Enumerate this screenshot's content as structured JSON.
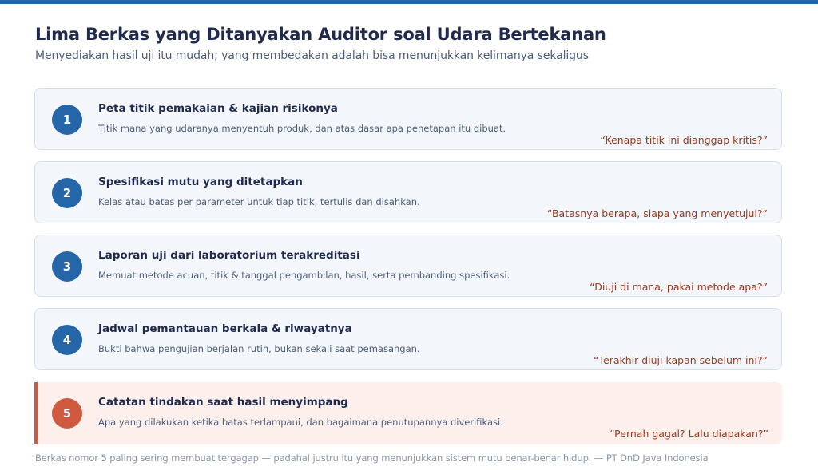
{
  "header": {
    "title": "Lima Berkas yang Ditanyakan Auditor soal Udara Bertekanan",
    "subtitle": "Menyediakan hasil uji itu mudah; yang membedakan adalah bisa menunjukkan kelimanya sekaligus"
  },
  "colors": {
    "accent": "#2566a8",
    "warning": "#cf5a3f",
    "quote": "#9a3a1f",
    "card_bg": "#f3f6fb",
    "warning_bg": "#fcefec"
  },
  "items": [
    {
      "number": "1",
      "title": "Peta titik pemakaian & kajian risikonya",
      "description": "Titik mana yang udaranya menyentuh produk, dan atas dasar apa penetapan itu dibuat.",
      "question": "“Kenapa titik ini dianggap kritis?”"
    },
    {
      "number": "2",
      "title": "Spesifikasi mutu yang ditetapkan",
      "description": "Kelas atau batas per parameter untuk tiap titik, tertulis dan disahkan.",
      "question": "“Batasnya berapa, siapa yang menyetujui?”"
    },
    {
      "number": "3",
      "title": "Laporan uji dari laboratorium terakreditasi",
      "description": "Memuat metode acuan, titik & tanggal pengambilan, hasil, serta pembanding spesifikasi.",
      "question": "“Diuji di mana, pakai metode apa?”"
    },
    {
      "number": "4",
      "title": "Jadwal pemantauan berkala & riwayatnya",
      "description": "Bukti bahwa pengujian berjalan rutin, bukan sekali saat pemasangan.",
      "question": "“Terakhir diuji kapan sebelum ini?”"
    },
    {
      "number": "5",
      "title": "Catatan tindakan saat hasil menyimpang",
      "description": "Apa yang dilakukan ketika batas terlampaui, dan bagaimana penutupannya diverifikasi.",
      "question": "“Pernah gagal? Lalu diapakan?”"
    }
  ],
  "footer": {
    "text": "Berkas nomor 5 paling sering membuat tergagap — padahal justru itu yang menunjukkan sistem mutu benar-benar hidup. — PT DnD Java Indonesia"
  }
}
